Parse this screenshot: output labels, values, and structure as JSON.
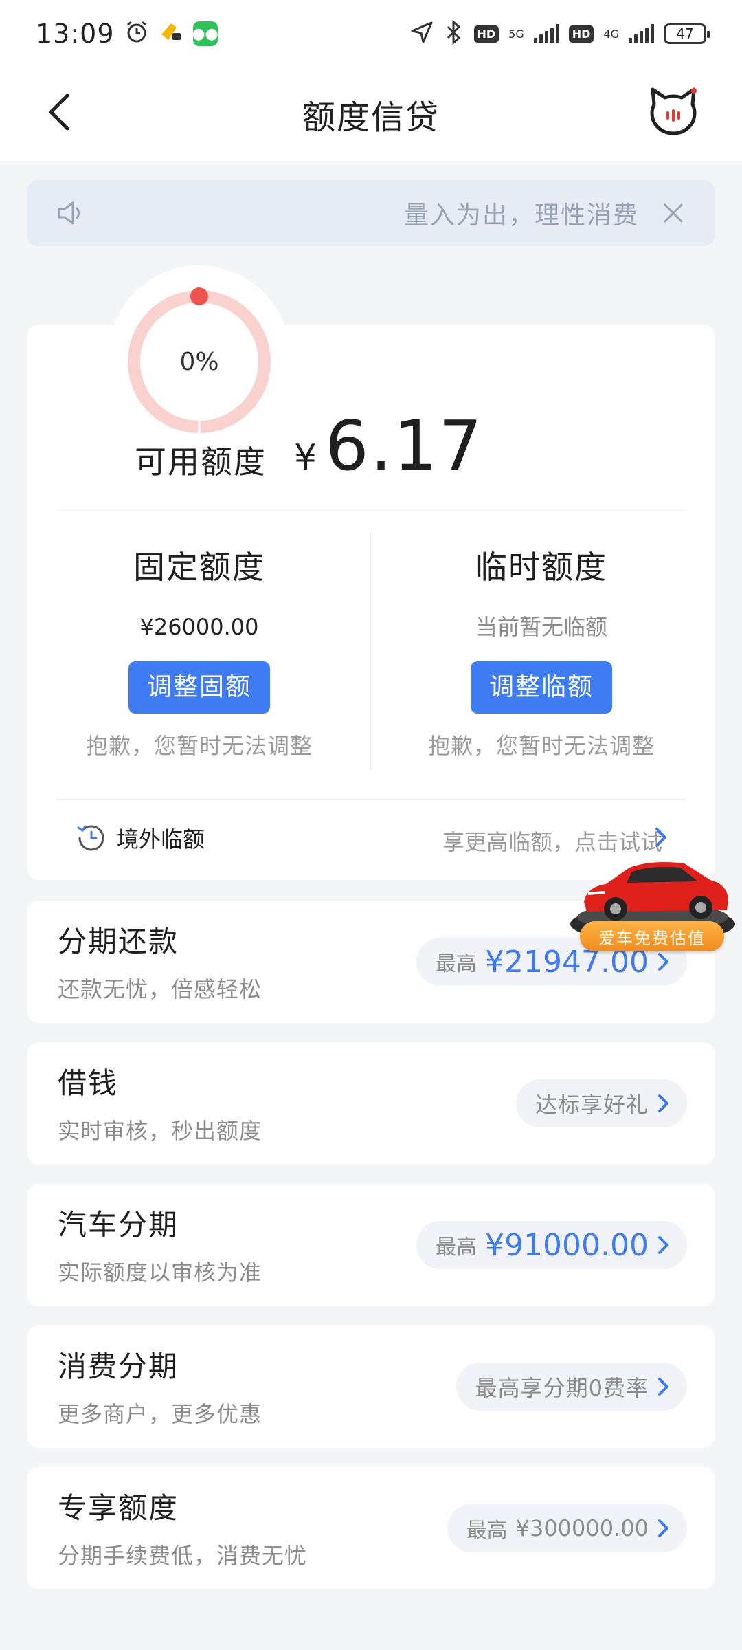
{
  "status_bar": {
    "time": "13:09",
    "net1": "5G",
    "net2": "4G",
    "hd": "HD",
    "battery": "47"
  },
  "navbar": {
    "title": "额度信贷"
  },
  "notice": {
    "text": "量入为出，理性消费"
  },
  "credit": {
    "usage_percent_label": "0%",
    "usage_fraction": 0,
    "available_label": "可用额度",
    "currency": "¥",
    "available_value": "6.17"
  },
  "fixed_quota": {
    "title": "固定额度",
    "value": "¥26000.00",
    "button": "调整固额",
    "note": "抱歉，您暂时无法调整"
  },
  "temp_quota": {
    "title": "临时额度",
    "value": "当前暂无临额",
    "button": "调整临额",
    "note": "抱歉，您暂时无法调整"
  },
  "overseas": {
    "label": "境外临额",
    "hint": "享更高临额，点击试试"
  },
  "products": [
    {
      "title": "分期还款",
      "subtitle": "还款无忧，倍感轻松",
      "prefix": "最高",
      "amount": "¥21947.00"
    },
    {
      "title": "借钱",
      "subtitle": "实时审核，秒出额度",
      "pill_text": "达标享好礼"
    },
    {
      "title": "汽车分期",
      "subtitle": "实际额度以审核为准",
      "prefix": "最高",
      "amount": "¥91000.00"
    },
    {
      "title": "消费分期",
      "subtitle": "更多商户，更多优惠",
      "pill_text": "最高享分期0费率"
    },
    {
      "title": "专享额度",
      "subtitle": "分期手续费低，消费无忧",
      "prefix": "最高",
      "muted_amount": "¥300000.00"
    }
  ],
  "car_ad": {
    "tag": "爱车免费估值"
  },
  "colors": {
    "accent": "#3f7cf4",
    "gauge_track": "#f9d2d0",
    "gauge_dot": "#ef5350",
    "page_bg": "#f4f5f7"
  }
}
